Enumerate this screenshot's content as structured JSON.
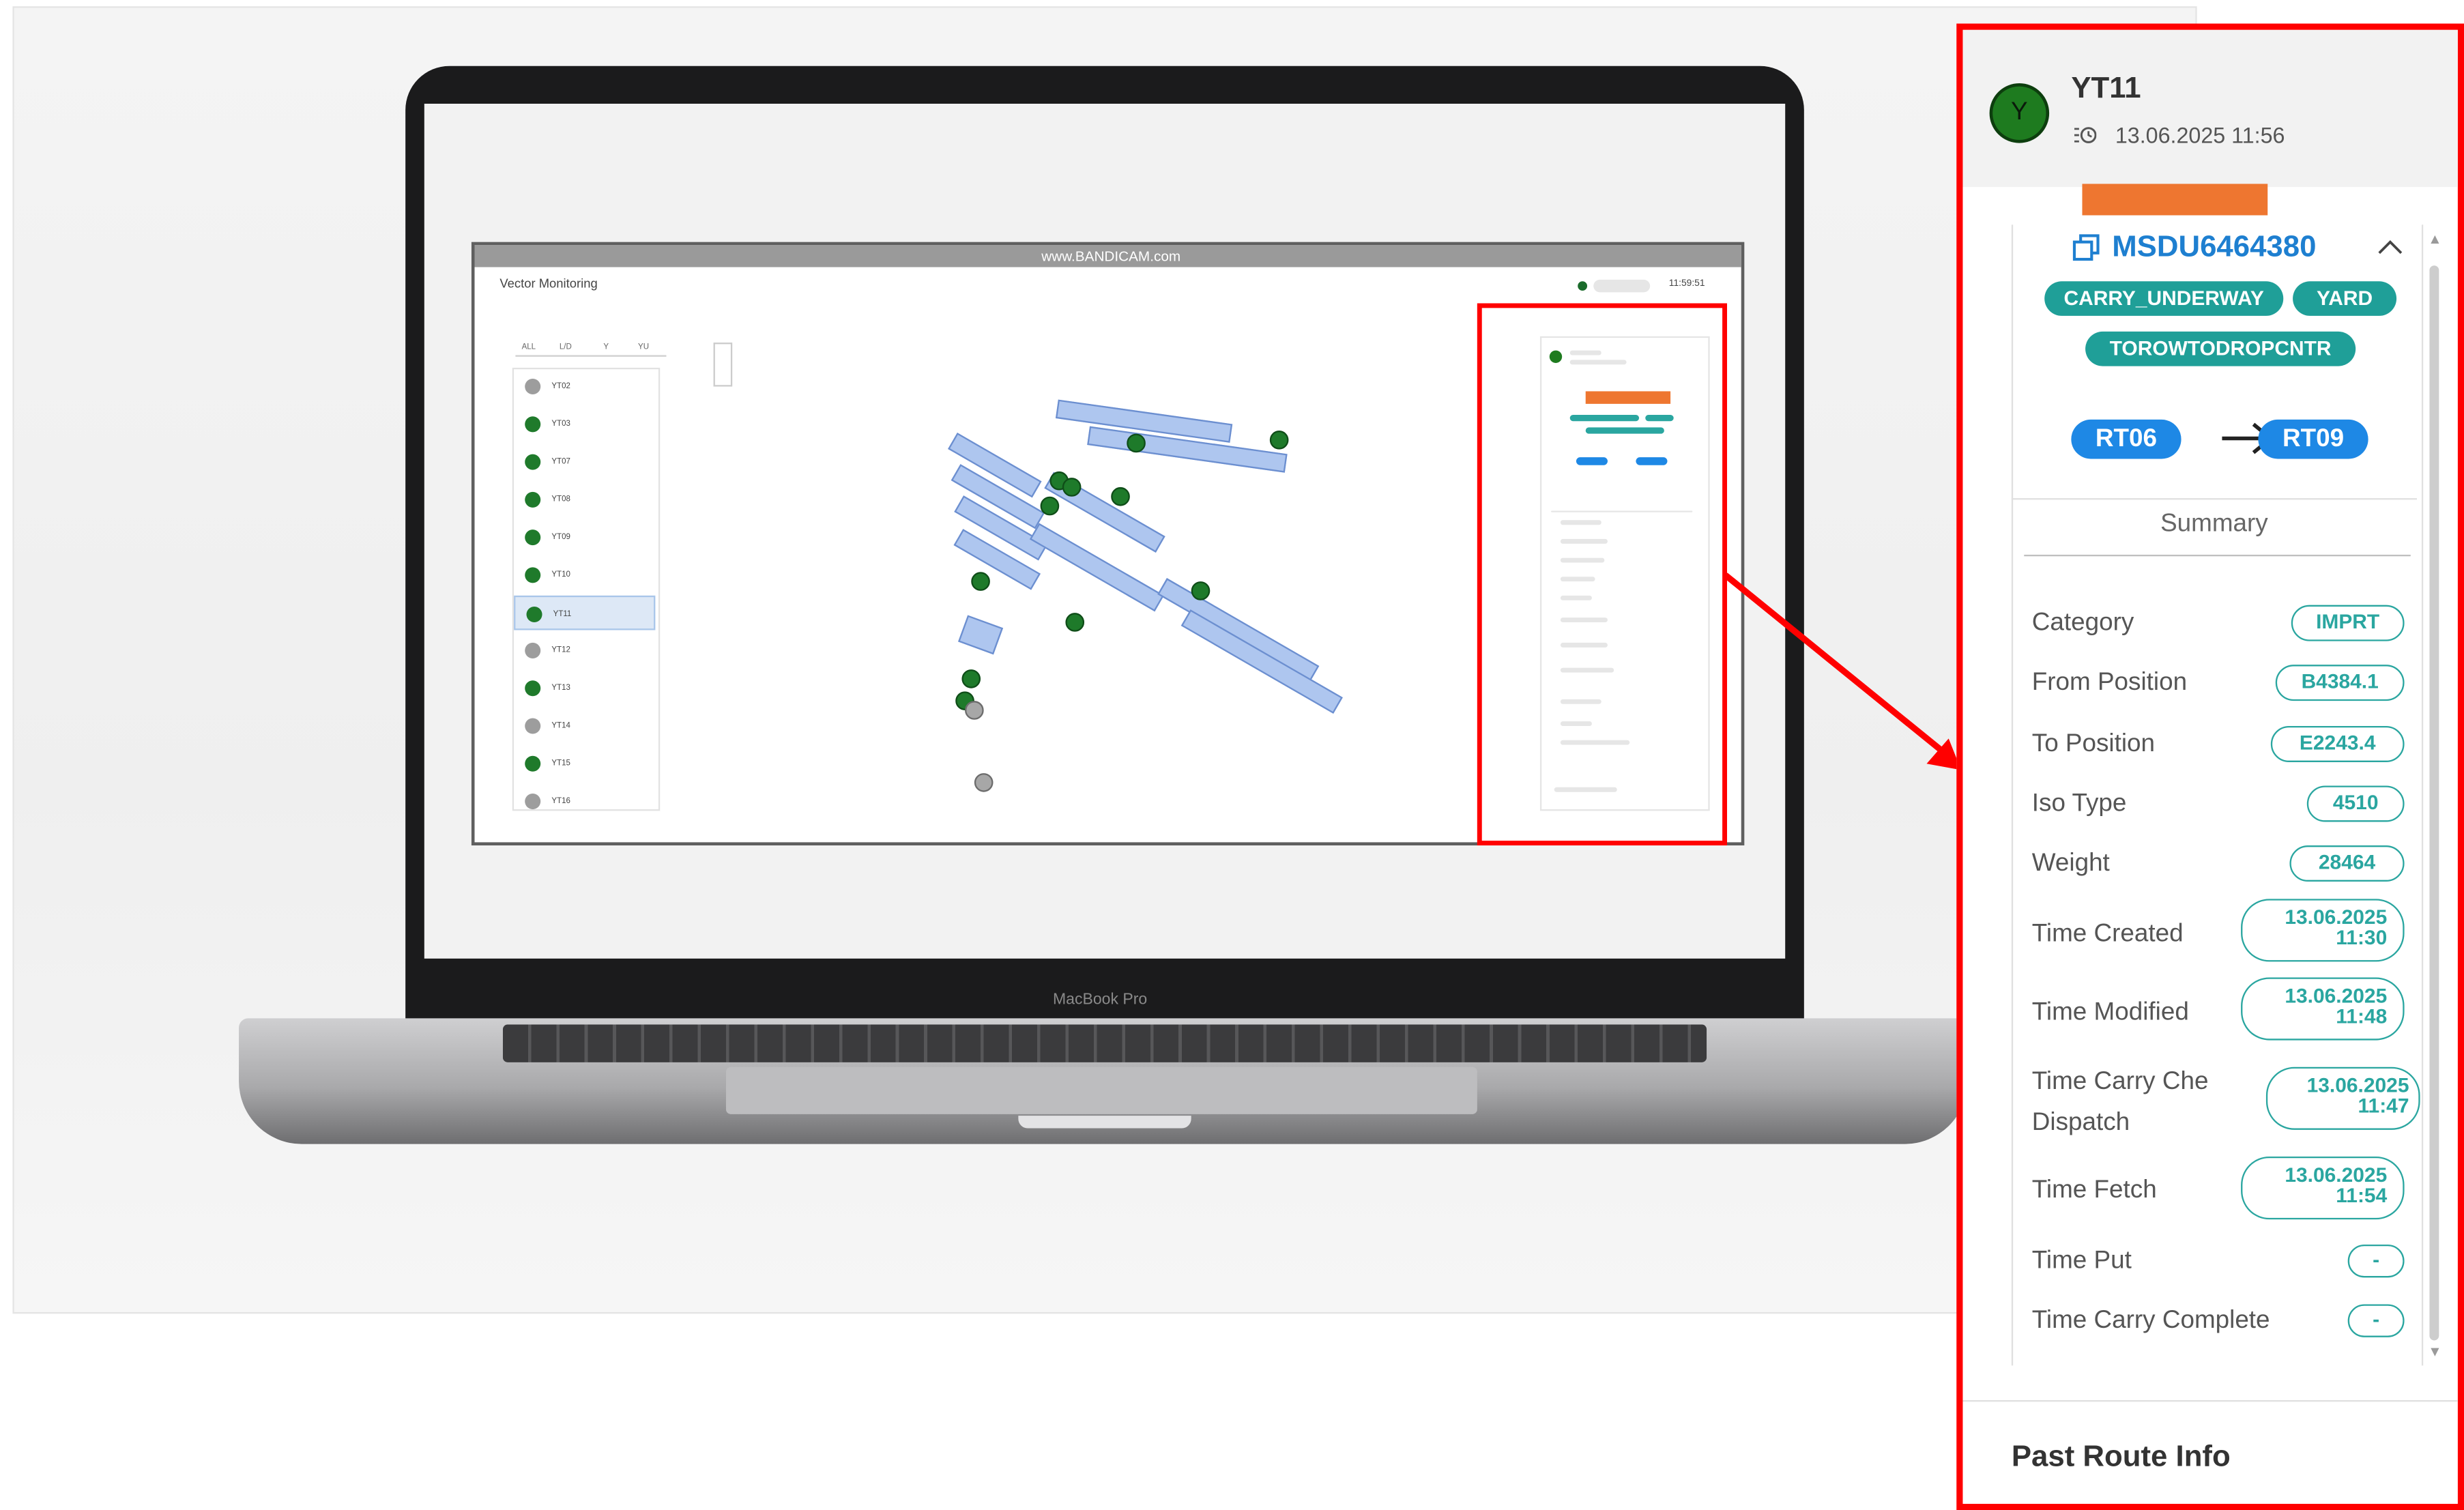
{
  "app": {
    "bandicam": "www.BANDICAM.com",
    "window_title": "Vector Monitoring",
    "connection_time": "11:59:51",
    "laptop_label": "MacBook Pro"
  },
  "tabs": [
    "ALL",
    "L/D",
    "Y",
    "YU"
  ],
  "vehicles": [
    {
      "id": "YT02",
      "status": "grey"
    },
    {
      "id": "YT03",
      "status": "green"
    },
    {
      "id": "YT07",
      "status": "green"
    },
    {
      "id": "YT08",
      "status": "green"
    },
    {
      "id": "YT09",
      "status": "green"
    },
    {
      "id": "YT10",
      "status": "green"
    },
    {
      "id": "YT11",
      "status": "green",
      "selected": true
    },
    {
      "id": "YT12",
      "status": "grey"
    },
    {
      "id": "YT13",
      "status": "green"
    },
    {
      "id": "YT14",
      "status": "grey"
    },
    {
      "id": "YT15",
      "status": "green"
    },
    {
      "id": "YT16",
      "status": "grey"
    }
  ],
  "detail": {
    "avatar_letter": "Y",
    "vehicle_id": "YT11",
    "timestamp": "13.06.2025 11:56",
    "container_no": "MSDU6464380",
    "tags": [
      "CARRY_UNDERWAY",
      "YARD",
      "TOROWTODROPCNTR"
    ],
    "route_from": "RT06",
    "route_to": "RT09",
    "summary_title": "Summary",
    "fields": [
      {
        "label": "Category",
        "value": "IMPRT"
      },
      {
        "label": "From Position",
        "value": "B4384.1"
      },
      {
        "label": "To Position",
        "value": "E2243.4"
      },
      {
        "label": "Iso Type",
        "value": "4510"
      },
      {
        "label": "Weight",
        "value": "28464"
      },
      {
        "label": "Time Created",
        "value_date": "13.06.2025",
        "value_time": "11:30"
      },
      {
        "label": "Time Modified",
        "value_date": "13.06.2025",
        "value_time": "11:48"
      },
      {
        "label": "Time Carry Che",
        "label2": "Dispatch",
        "value_date": "13.06.2025",
        "value_time": "11:47"
      },
      {
        "label": "Time Fetch",
        "value_date": "13.06.2025",
        "value_time": "11:54"
      },
      {
        "label": "Time Put",
        "value": "-"
      },
      {
        "label": "Time Carry Complete",
        "value": "-"
      }
    ],
    "past_route": "Past Route Info"
  },
  "colors": {
    "annotation_red": "#ff0000",
    "teal": "#2aa6a0",
    "blue": "#1e88e5",
    "green": "#1e7b1f",
    "redaction_orange": "#ee7630"
  }
}
